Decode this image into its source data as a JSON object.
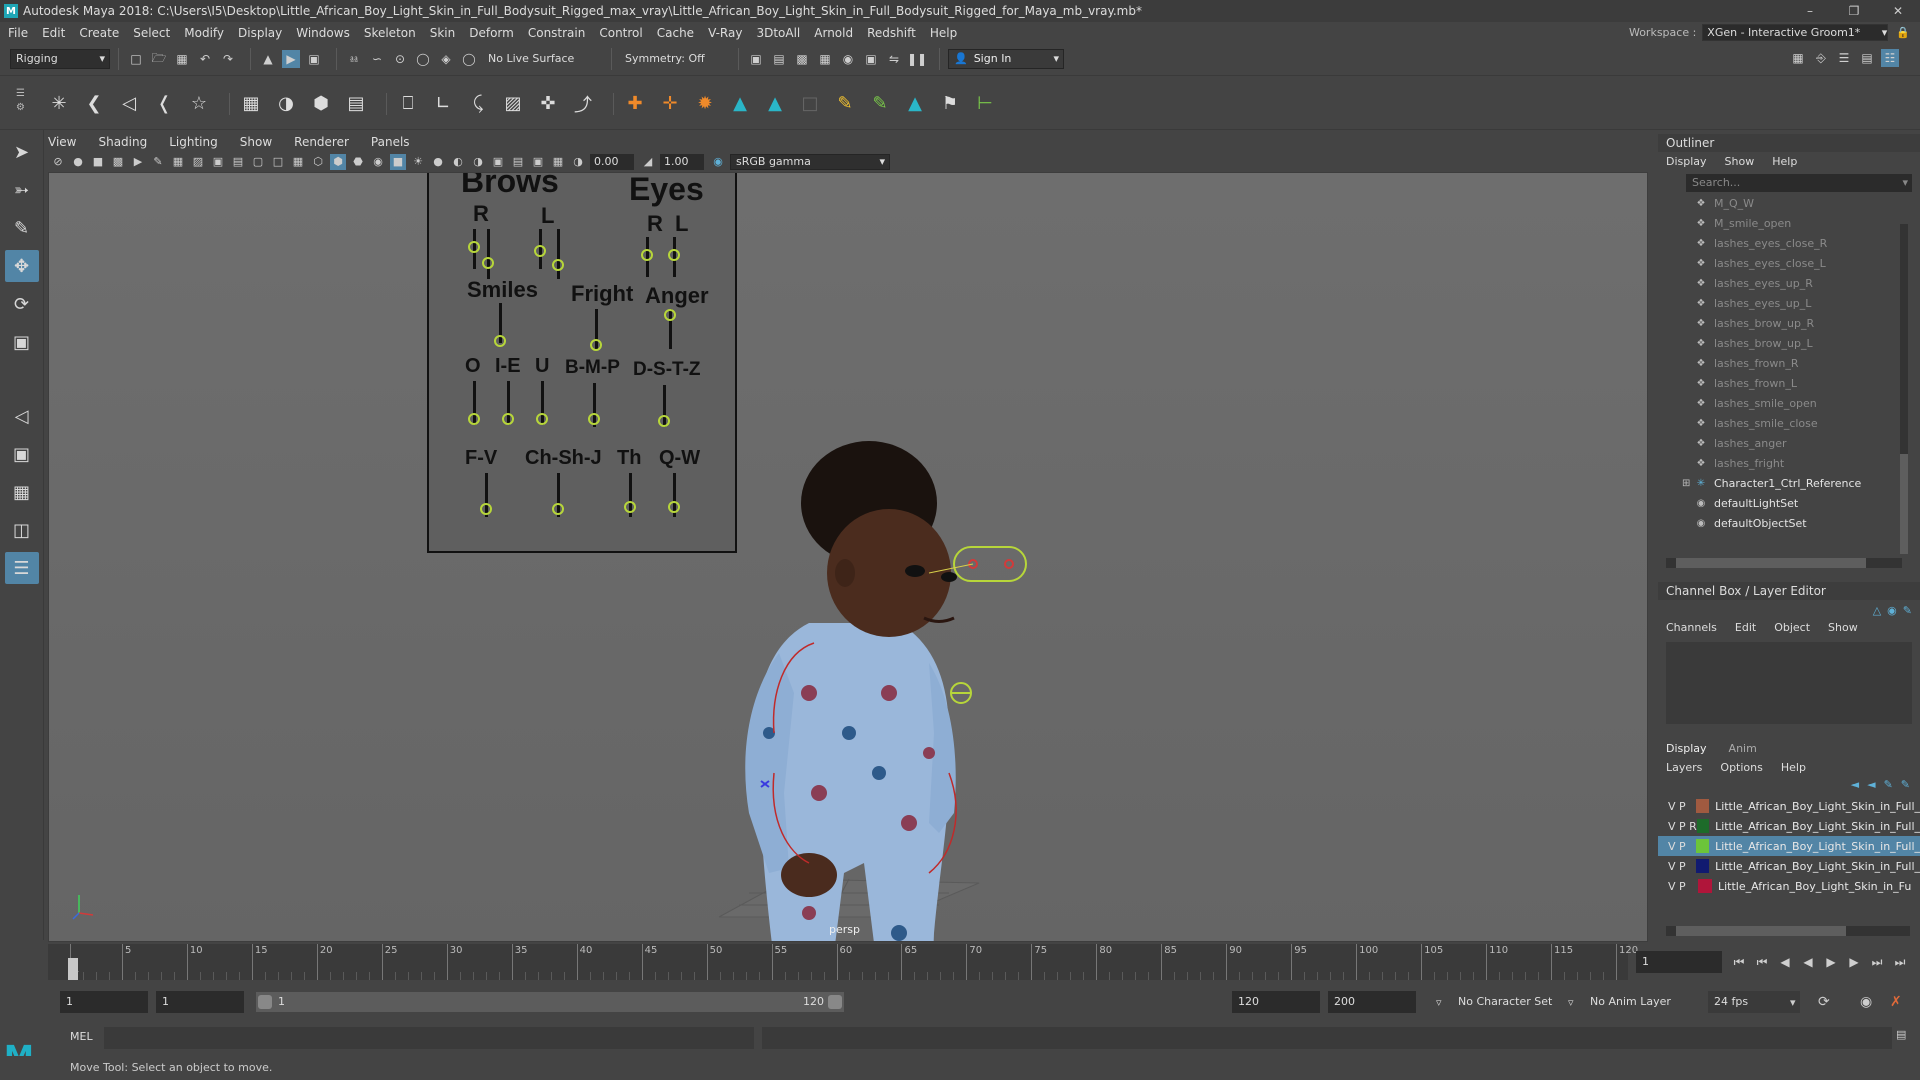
{
  "window": {
    "title": "Autodesk Maya 2018: C:\\Users\\I5\\Desktop\\Little_African_Boy_Light_Skin_in_Full_Bodysuit_Rigged_max_vray\\Little_African_Boy_Light_Skin_in_Full_Bodysuit_Rigged_for_Maya_mb_vray.mb*"
  },
  "menu": [
    "File",
    "Edit",
    "Create",
    "Select",
    "Modify",
    "Display",
    "Windows",
    "Skeleton",
    "Skin",
    "Deform",
    "Constrain",
    "Control",
    "Cache",
    "V-Ray",
    "3DtoAll",
    "Arnold",
    "Redshift",
    "Help"
  ],
  "workspace": {
    "label": "Workspace :",
    "value": "XGen - Interactive Groom1*"
  },
  "status": {
    "mode": "Rigging",
    "live_surface": "No Live Surface",
    "symmetry": "Symmetry: Off",
    "sign_in": "Sign In"
  },
  "viewport_menu": [
    "View",
    "Shading",
    "Lighting",
    "Show",
    "Renderer",
    "Panels"
  ],
  "viewport_toolbar": {
    "exposure": "0.00",
    "gamma": "1.00",
    "colorspace": "sRGB gamma"
  },
  "face_panel": {
    "brows": "Brows",
    "eyes": "Eyes",
    "brows_r": "R",
    "brows_l": "L",
    "eyes_r": "R",
    "eyes_l": "L",
    "smiles": "Smiles",
    "fright": "Fright",
    "anger": "Anger",
    "o": "O",
    "he": "I-E",
    "u": "U",
    "bmp": "B-M-P",
    "dstz": "D-S-T-Z",
    "fv": "F-V",
    "chshj": "Ch-Sh-J",
    "th": "Th",
    "qw": "Q-W"
  },
  "camera": "persp",
  "outliner": {
    "title": "Outliner",
    "menu": [
      "Display",
      "Show",
      "Help"
    ],
    "search": "Search...",
    "items": [
      {
        "name": "M_Q_W",
        "dim": true
      },
      {
        "name": "M_smile_open",
        "dim": true
      },
      {
        "name": "lashes_eyes_close_R",
        "dim": true
      },
      {
        "name": "lashes_eyes_close_L",
        "dim": true
      },
      {
        "name": "lashes_eyes_up_R",
        "dim": true
      },
      {
        "name": "lashes_eyes_up_L",
        "dim": true
      },
      {
        "name": "lashes_brow_up_R",
        "dim": true
      },
      {
        "name": "lashes_brow_up_L",
        "dim": true
      },
      {
        "name": "lashes_frown_R",
        "dim": true
      },
      {
        "name": "lashes_frown_L",
        "dim": true
      },
      {
        "name": "lashes_smile_open",
        "dim": true
      },
      {
        "name": "lashes_smile_close",
        "dim": true
      },
      {
        "name": "lashes_anger",
        "dim": true
      },
      {
        "name": "lashes_fright",
        "dim": true
      },
      {
        "name": "Character1_Ctrl_Reference",
        "dim": false
      },
      {
        "name": "defaultLightSet",
        "dim": false
      },
      {
        "name": "defaultObjectSet",
        "dim": false
      }
    ]
  },
  "channel_box": {
    "title": "Channel Box / Layer Editor",
    "menu": [
      "Channels",
      "Edit",
      "Object",
      "Show"
    ]
  },
  "layer_editor": {
    "tabs": [
      "Display",
      "Anim"
    ],
    "menu": [
      "Layers",
      "Options",
      "Help"
    ],
    "layers": [
      {
        "vp": "V  P",
        "name": "Little_African_Boy_Light_Skin_in_Full_",
        "color": "#a05a40"
      },
      {
        "vp": "V  P  R",
        "name": "Little_African_Boy_Light_Skin_in_Full_",
        "color": "#1d6b2a"
      },
      {
        "vp": "V  P",
        "name": "Little_African_Boy_Light_Skin_in_Full_",
        "color": "#6cc43a"
      },
      {
        "vp": "V  P",
        "name": "Little_African_Boy_Light_Skin_in_Full_",
        "color": "#111a70"
      },
      {
        "vp": "V  P",
        "name": "Little_African_Boy_Light_Skin_in_Fu",
        "color": "#b0153a"
      }
    ]
  },
  "timeline": {
    "ticks": [
      "1",
      "5",
      "10",
      "15",
      "20",
      "25",
      "30",
      "35",
      "40",
      "45",
      "50",
      "55",
      "60",
      "65",
      "70",
      "75",
      "80",
      "85",
      "90",
      "95",
      "100",
      "105",
      "110",
      "115",
      "120"
    ],
    "current": "1"
  },
  "range": {
    "start": "1",
    "playstart": "1",
    "slider_start": "1",
    "slider_end": "120",
    "playend": "120",
    "end": "200",
    "charset": "No Character Set",
    "animlayer": "No Anim Layer",
    "fps": "24 fps"
  },
  "cmd": {
    "label": "MEL"
  },
  "help": "Move Tool: Select an object to move."
}
